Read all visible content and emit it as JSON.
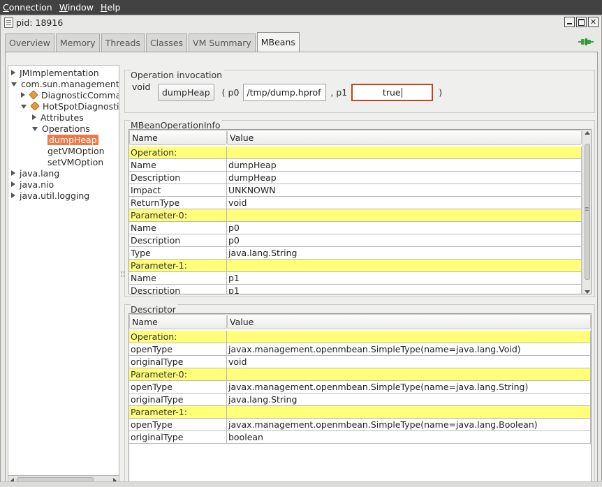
{
  "menubar": {
    "items": [
      {
        "mnemonic": "C",
        "rest": "onnection"
      },
      {
        "mnemonic": "W",
        "rest": "indow"
      },
      {
        "mnemonic": "H",
        "rest": "elp"
      }
    ]
  },
  "window": {
    "title": "pid: 18916"
  },
  "tabs": [
    "Overview",
    "Memory",
    "Threads",
    "Classes",
    "VM Summary",
    "MBeans"
  ],
  "active_tab": "MBeans",
  "tree": {
    "items": [
      {
        "label": "JMImplementation",
        "expander": "right",
        "icon": "",
        "level": 0
      },
      {
        "label": "com.sun.management",
        "expander": "down",
        "icon": "",
        "level": 0
      },
      {
        "label": "DiagnosticCommand",
        "expander": "right",
        "icon": "bean-icon",
        "level": 1
      },
      {
        "label": "HotSpotDiagnostic",
        "expander": "down",
        "icon": "bean-icon",
        "level": 1
      },
      {
        "label": "Attributes",
        "expander": "right",
        "icon": "",
        "level": 2
      },
      {
        "label": "Operations",
        "expander": "down",
        "icon": "",
        "level": 2
      },
      {
        "label": "dumpHeap",
        "expander": "",
        "icon": "",
        "level": 3,
        "selected": true
      },
      {
        "label": "getVMOption",
        "expander": "",
        "icon": "",
        "level": 3
      },
      {
        "label": "setVMOption",
        "expander": "",
        "icon": "",
        "level": 3
      },
      {
        "label": "java.lang",
        "expander": "right",
        "icon": "",
        "level": 0
      },
      {
        "label": "java.nio",
        "expander": "right",
        "icon": "",
        "level": 0
      },
      {
        "label": "java.util.logging",
        "expander": "right",
        "icon": "",
        "level": 0
      }
    ]
  },
  "operation_invocation": {
    "title": "Operation invocation",
    "return_type": "void",
    "button_label": "dumpHeap",
    "open_paren": "( p0",
    "p0_value": "/tmp/dump.hprof",
    "sep_p1": ", p1",
    "p1_value": "true",
    "close_paren": ")"
  },
  "mbean_operation_info": {
    "title": "MBeanOperationInfo",
    "columns": [
      "Name",
      "Value"
    ],
    "rows": [
      {
        "name": "Operation:",
        "value": "",
        "header": true
      },
      {
        "name": "Name",
        "value": "dumpHeap"
      },
      {
        "name": "Description",
        "value": "dumpHeap"
      },
      {
        "name": "Impact",
        "value": "UNKNOWN"
      },
      {
        "name": "ReturnType",
        "value": "void"
      },
      {
        "name": "Parameter-0:",
        "value": "",
        "header": true
      },
      {
        "name": "Name",
        "value": "p0"
      },
      {
        "name": "Description",
        "value": "p0"
      },
      {
        "name": "Type",
        "value": "java.lang.String"
      },
      {
        "name": "Parameter-1:",
        "value": "",
        "header": true
      },
      {
        "name": "Name",
        "value": "p1"
      },
      {
        "name": "Description",
        "value": "p1"
      }
    ]
  },
  "descriptor": {
    "title": "Descriptor",
    "columns": [
      "Name",
      "Value"
    ],
    "rows": [
      {
        "name": "Operation:",
        "value": "",
        "header": true
      },
      {
        "name": "openType",
        "value": "javax.management.openmbean.SimpleType(name=java.lang.Void)"
      },
      {
        "name": "originalType",
        "value": "void"
      },
      {
        "name": "Parameter-0:",
        "value": "",
        "header": true
      },
      {
        "name": "openType",
        "value": "javax.management.openmbean.SimpleType(name=java.lang.String)"
      },
      {
        "name": "originalType",
        "value": "java.lang.String"
      },
      {
        "name": "Parameter-1:",
        "value": "",
        "header": true
      },
      {
        "name": "openType",
        "value": "javax.management.openmbean.SimpleType(name=java.lang.Boolean)"
      },
      {
        "name": "originalType",
        "value": "boolean"
      }
    ]
  },
  "colors": {
    "menubar_bg": "#424242",
    "selection": "#f07746",
    "table_section_highlight": "#ffff7a",
    "focus_border": "#c2441c",
    "plug_icon": "#3aa33a"
  }
}
